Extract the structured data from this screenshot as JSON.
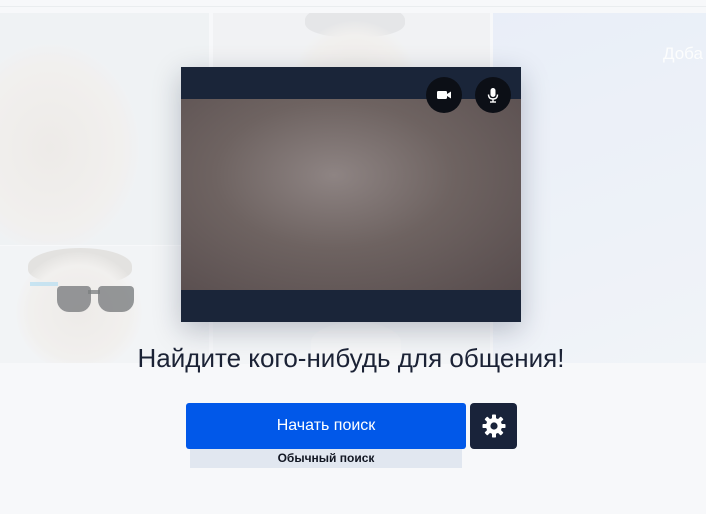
{
  "background": {
    "partial_tile_text": "Доба"
  },
  "preview": {
    "camera_button_icon": "video-camera-icon",
    "mic_button_icon": "microphone-icon"
  },
  "main": {
    "headline": "Найдите кого-нибудь для общения!",
    "start_button_label": "Начать поиск",
    "settings_button_icon": "gear-icon",
    "search_mode_label": "Обычный поиск"
  },
  "colors": {
    "primary_button": "#0158e9",
    "dark_navy": "#19233a",
    "mode_label_bg": "#e1e7f0"
  }
}
